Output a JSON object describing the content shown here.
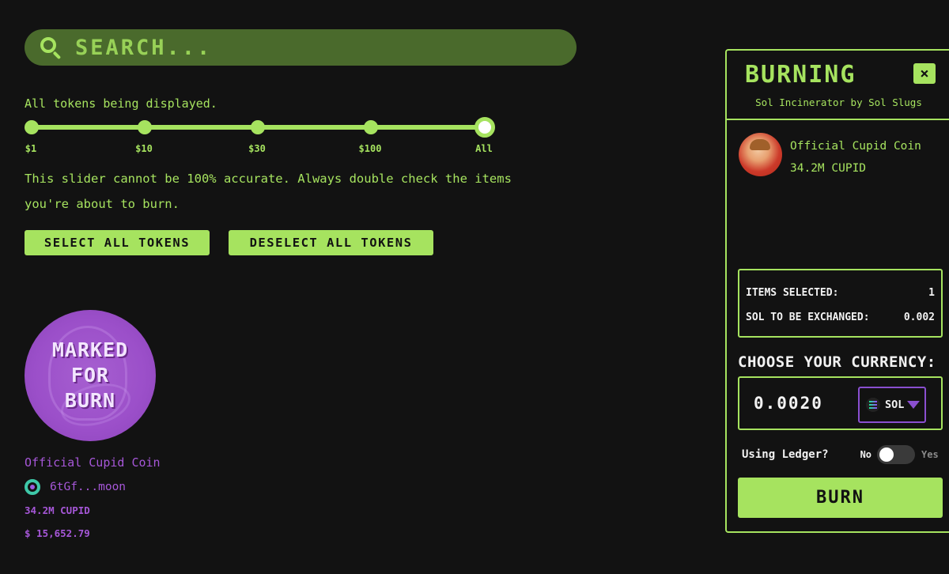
{
  "search": {
    "placeholder": "SEARCH..."
  },
  "filter": {
    "status": "All tokens being displayed.",
    "stops": [
      "$1",
      "$10",
      "$30",
      "$100",
      "All"
    ],
    "selected_stop": "All",
    "disclaimer": "This slider cannot be 100% accurate. Always double check the items you're about to burn."
  },
  "actions": {
    "select_all": "SELECT ALL TOKENS",
    "deselect_all": "DESELECT ALL TOKENS"
  },
  "token": {
    "stamp": [
      "MARKED",
      "FOR",
      "BURN"
    ],
    "name": "Official Cupid Coin",
    "address": "6tGf...moon",
    "amount": "34.2M CUPID",
    "value": "$ 15,652.79"
  },
  "panel": {
    "title": "BURNING",
    "close": "×",
    "subtitle": "Sol Incinerator by Sol Slugs",
    "selected_item": {
      "name": "Official Cupid Coin",
      "amount": "34.2M CUPID"
    },
    "summary": {
      "items_label": "ITEMS SELECTED:",
      "items_value": "1",
      "sol_label": "SOL TO BE EXCHANGED:",
      "sol_value": "0.002"
    },
    "currency": {
      "label": "CHOOSE YOUR CURRENCY:",
      "value": "0.0020",
      "code": "SOL"
    },
    "ledger": {
      "label": "Using Ledger?",
      "no": "No",
      "yes": "Yes",
      "enabled": false
    },
    "burn": "BURN"
  },
  "colors": {
    "accent": "#a6e35f",
    "purple": "#a657d8",
    "background": "#121212"
  }
}
